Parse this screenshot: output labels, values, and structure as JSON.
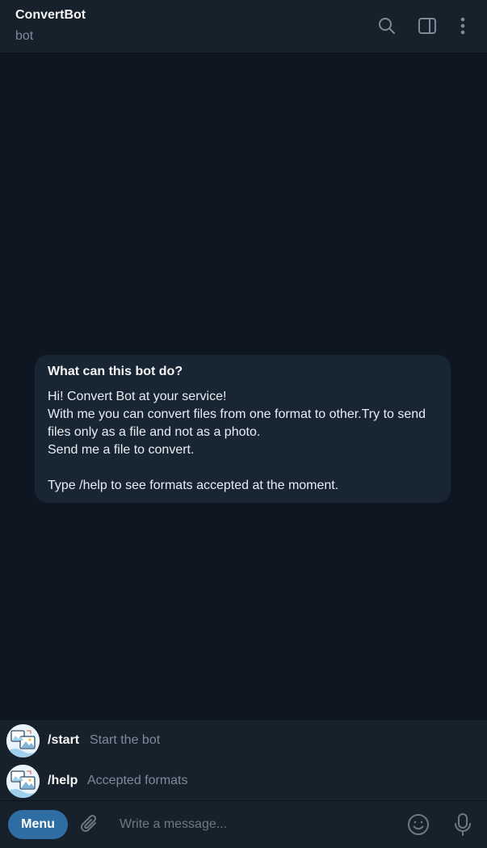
{
  "header": {
    "title": "ConvertBot",
    "subtitle": "bot",
    "icons": [
      "search-icon",
      "sidebar-toggle-icon",
      "more-vertical-icon"
    ]
  },
  "info_card": {
    "title": "What can this bot do?",
    "body": "Hi! Convert Bot at your service!\nWith me you can convert files from one format to other.Try to send files only as a file and not as a photo.\nSend me a file to convert.\n\nType /help to see formats accepted at the moment."
  },
  "commands": [
    {
      "name": "/start",
      "description": "Start the bot"
    },
    {
      "name": "/help",
      "description": "Accepted formats"
    }
  ],
  "composer": {
    "menu_label": "Menu",
    "placeholder": "Write a message...",
    "icons": [
      "attach-icon",
      "emoji-icon",
      "microphone-icon"
    ]
  },
  "colors": {
    "background": "#0e1621",
    "panel": "#17212b",
    "card": "#182533",
    "accent": "#2f6ea5",
    "muted_text": "#7d8b99"
  }
}
